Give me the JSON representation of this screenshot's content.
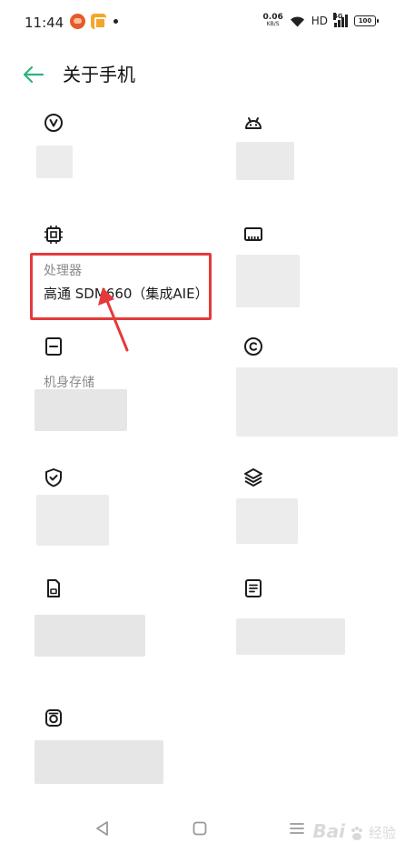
{
  "status_bar": {
    "time": "11:44",
    "net_speed_value": "0.06",
    "net_speed_unit": "KB/S",
    "hd": "HD",
    "signal_type": "4G",
    "battery_level": "100"
  },
  "header": {
    "title": "关于手机"
  },
  "processor": {
    "label": "处理器",
    "value": "高通 SDM660（集成AIE）"
  },
  "storage": {
    "label": "机身存储"
  },
  "icons": {
    "version": "version-icon",
    "android": "android-icon",
    "processor": "chip-icon",
    "ram": "ram-icon",
    "storage": "storage-icon",
    "copyright": "copyright-icon",
    "security": "shield-icon",
    "layers": "layers-icon",
    "sim": "sim-card-icon",
    "document": "document-icon",
    "camera": "camera-icon"
  },
  "colors": {
    "accent": "#2bb47a",
    "highlight": "#e53a3a"
  },
  "watermark": {
    "brand": "Bai",
    "suffix": "经验"
  }
}
